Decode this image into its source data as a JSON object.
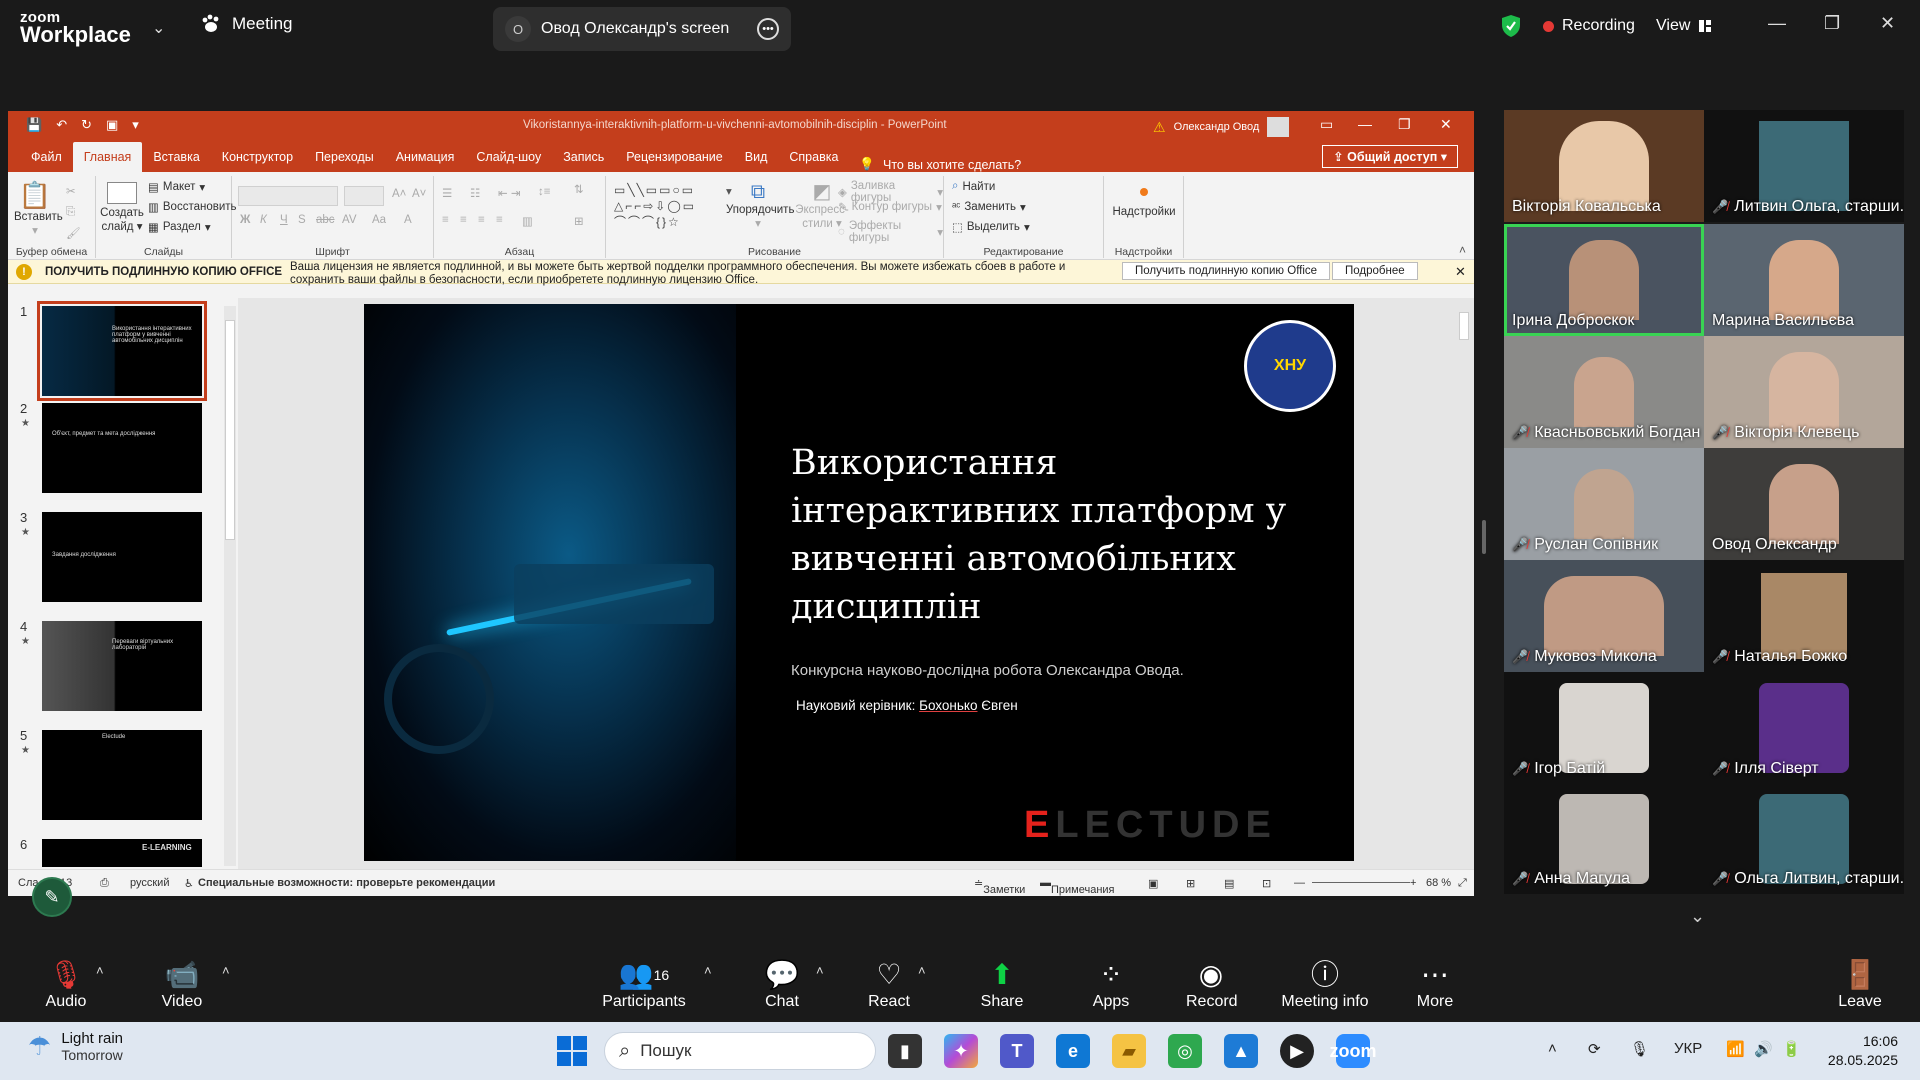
{
  "zoom": {
    "logo_line1": "zoom",
    "logo_line2": "Workplace",
    "meeting_label": "Meeting",
    "screen_label": "Овод Олександр's screen",
    "recording_label": "Recording",
    "view_label": "View"
  },
  "ppt": {
    "doc_title": "Vikoristannya-interaktivnih-platform-u-vivchenni-avtomobilnih-disciplin  -  PowerPoint",
    "user": "Олександр Овод",
    "tabs": [
      "Файл",
      "Главная",
      "Вставка",
      "Конструктор",
      "Переходы",
      "Анимация",
      "Слайд-шоу",
      "Запись",
      "Рецензирование",
      "Вид",
      "Справка"
    ],
    "tell_me": "Что вы хотите сделать?",
    "share": "Общий доступ",
    "ribbon": {
      "paste": "Вставить",
      "clipboard": "Буфер обмена",
      "new_slide_1": "Создать",
      "new_slide_2": "слайд",
      "layout": "Макет",
      "reset": "Восстановить",
      "section": "Раздел",
      "slides": "Слайды",
      "font": "Шрифт",
      "paragraph": "Абзац",
      "arrange": "Упорядочить",
      "quick_styles_1": "Экспресс-",
      "quick_styles_2": "стили",
      "fill": "Заливка фигуры",
      "outline": "Контур фигуры",
      "effects": "Эффекты фигуры",
      "drawing": "Рисование",
      "find": "Найти",
      "replace": "Заменить",
      "select": "Выделить",
      "editing": "Редактирование",
      "addins": "Надстройки",
      "addins_group": "Надстройки"
    },
    "infobar": {
      "title": "ПОЛУЧИТЬ ПОДЛИННУЮ КОПИЮ OFFICE",
      "message": "Ваша лицензия не является подлинной, и вы можете быть жертвой подделки программного обеспечения. Вы можете избежать сбоев в работе и сохранить ваши файлы в безопасности, если приобретете подлинную лицензию Office.",
      "get_button": "Получить подлинную копию Office",
      "more_button": "Подробнее"
    },
    "slide": {
      "title": "Використання інтерактивних платформ у вивченні автомобільних дисциплін",
      "subtitle": "Конкурсна науково-дослідна робота Олександра Овода.",
      "supervisor_label": "Науковий керівник:",
      "supervisor_surname": "Бохонько",
      "supervisor_name": "Євген",
      "logo_text": "ХНУ",
      "brand": "LECTUDE",
      "brand_e": "E"
    },
    "thumbnails": [
      {
        "num": "1",
        "text": "Використання інтерактивних платформ у вивченні автомобільних дисциплін"
      },
      {
        "num": "2",
        "text": "Об'єкт, предмет та мета дослідження"
      },
      {
        "num": "3",
        "text": "Завдання дослідження"
      },
      {
        "num": "4",
        "text": "Переваги віртуальних лабораторій"
      },
      {
        "num": "5",
        "text": "Electude"
      },
      {
        "num": "6",
        "text": "E-LEARNING"
      }
    ],
    "status": {
      "slide": "Сла",
      "slide_count": "13",
      "language": "русский",
      "accessibility": "Специальные возможности: проверьте рекомендации",
      "notes": "Заметки",
      "comments": "Примечания",
      "zoom": "68 %"
    }
  },
  "participants": [
    {
      "name": "Вікторія Ковальська",
      "muted": false,
      "speaking": false
    },
    {
      "name": "Литвин Ольга, старши...",
      "muted": true,
      "speaking": false
    },
    {
      "name": "Ірина Доброскок",
      "muted": false,
      "speaking": true
    },
    {
      "name": "Марина Васильєва",
      "muted": false,
      "speaking": false
    },
    {
      "name": "Квасньовський Богдан",
      "muted": true,
      "speaking": false
    },
    {
      "name": "Вікторія Клевець",
      "muted": true,
      "speaking": false
    },
    {
      "name": "Руслан Сопівник",
      "muted": true,
      "speaking": false
    },
    {
      "name": "Овод Олександр",
      "muted": false,
      "speaking": false
    },
    {
      "name": "Муковоз Микола",
      "muted": true,
      "speaking": false
    },
    {
      "name": "Наталья Божко",
      "muted": true,
      "speaking": false
    },
    {
      "name": "Ігор Батій",
      "muted": true,
      "speaking": false
    },
    {
      "name": "Ілля Сіверт",
      "muted": true,
      "speaking": false
    },
    {
      "name": "Анна Магула",
      "muted": true,
      "speaking": false
    },
    {
      "name": "Ольга Литвин, старши...",
      "muted": true,
      "speaking": false
    }
  ],
  "toolbar": {
    "audio": "Audio",
    "video": "Video",
    "participants": "Participants",
    "participants_count": "16",
    "chat": "Chat",
    "react": "React",
    "share": "Share",
    "apps": "Apps",
    "record": "Record",
    "meeting_info": "Meeting info",
    "more": "More",
    "leave": "Leave"
  },
  "taskbar": {
    "weather_title": "Light rain",
    "weather_sub": "Tomorrow",
    "search_placeholder": "Пошук",
    "lang": "УКР",
    "time": "16:06",
    "date": "28.05.2025"
  },
  "colors": {
    "ppt_accent": "#c43e1c",
    "speaking": "#39d353",
    "recording": "#e53935",
    "share": "#0ed145"
  }
}
